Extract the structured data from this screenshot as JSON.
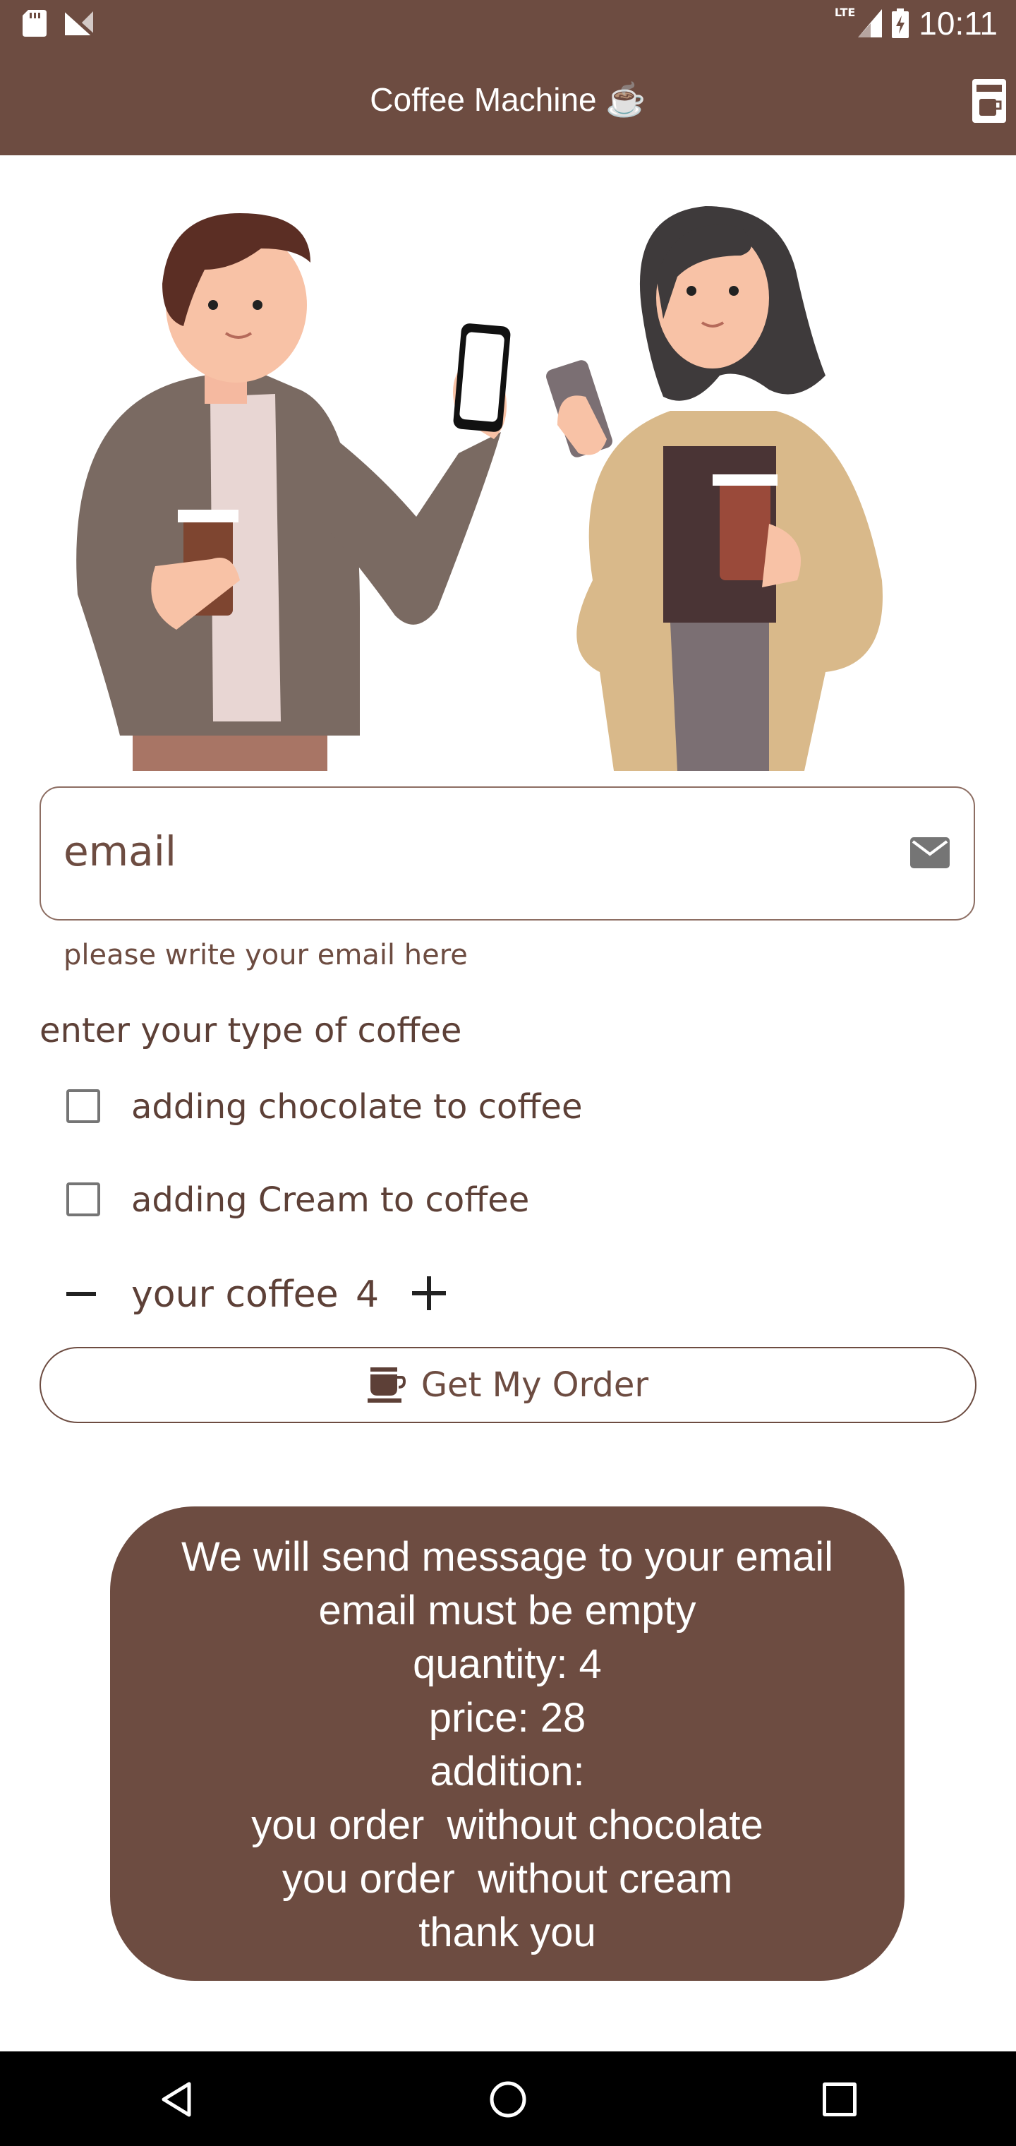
{
  "status_bar": {
    "time": "10:11",
    "network": "LTE",
    "icons": [
      "sd-card-icon",
      "no-signal-icon",
      "signal-icon",
      "battery-charging-icon"
    ]
  },
  "app_bar": {
    "title": "Coffee Machine",
    "title_icon": "☕",
    "action_icon": "coffee-machine-icon"
  },
  "form": {
    "email_label": "email",
    "email_helper": "please write your email here",
    "section_label": "enter your type of coffee",
    "chocolate_label": "adding chocolate to coffee",
    "cream_label": "adding Cream to coffee",
    "chocolate_checked": false,
    "cream_checked": false,
    "quantity_label": "your coffee",
    "quantity_value": "4",
    "order_button_label": "Get My Order"
  },
  "toast": {
    "lines": [
      "We will send message to your email",
      "email must be empty",
      "quantity: 4",
      "price: 28",
      "addition:",
      "you order  without chocolate",
      "you order  without cream",
      "thank you"
    ]
  },
  "colors": {
    "primary": "#6d4c41",
    "text": "#5d4037",
    "background": "#ffffff",
    "nav_bar": "#000000"
  }
}
